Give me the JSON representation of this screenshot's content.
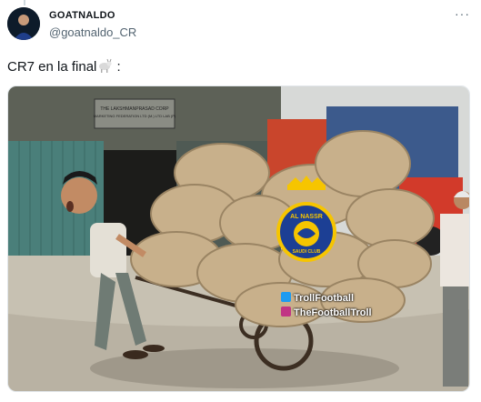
{
  "author": {
    "display_name": "GOATNALDO",
    "handle": "@goatnaldo_CR",
    "avatar_icon": "avatar-icon"
  },
  "tweet": {
    "text": "CR7 en la final",
    "emoji_icon": "goat-emoji-icon",
    "suffix": " :"
  },
  "more_label": "···",
  "media": {
    "sign_lines": [
      "THE LAKSHMANPRASAD CORP",
      "MARKETING FEDERATION LTD (M.) LTD LAB (P)"
    ],
    "badge_text_top": "AL NASSR",
    "badge_text_bottom": "SAUDI CLUB",
    "watermark_twitter": "TrollFootball",
    "watermark_instagram": "TheFootballTroll"
  },
  "colors": {
    "text_primary": "#0f1419",
    "text_secondary": "#536471",
    "badge_blue": "#1c3f94",
    "badge_yellow": "#f6c500"
  }
}
